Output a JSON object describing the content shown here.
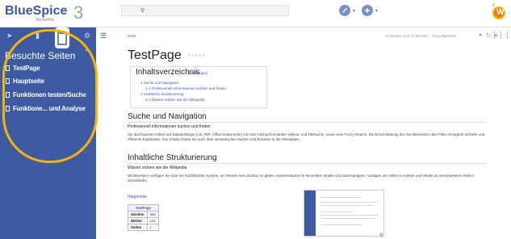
{
  "header": {
    "logo_text": "BlueSpice",
    "logo_sub": "MediaWiki",
    "logo_number": "3",
    "search_icon": "search-icon",
    "notif_label": "8",
    "avatar_letter": "W"
  },
  "sidebar": {
    "section_title": "Besuchte Seiten",
    "items": [
      {
        "label": "TestPage"
      },
      {
        "label": "Hauptseite"
      },
      {
        "label": "Funktionen testen/Suche"
      },
      {
        "label": "Funktione... und Analyse"
      }
    ]
  },
  "main": {
    "breadcrumb": "Seite",
    "meta": "6 Stunden und 22 Minuten - Greg Eigentum",
    "title": "TestPage",
    "toc": {
      "title": "Inhaltsverzeichnis",
      "hide_label": "[Verbergen]",
      "items": [
        {
          "label": "1   Suche und Navigation"
        },
        {
          "label": "1.1   Professionell informationen suchen und finden"
        },
        {
          "label": "2   Inhaltliche Strukturierung"
        },
        {
          "label": "2.1   Wissen ordnen wie die Wikipedia"
        }
      ]
    },
    "sections": [
      {
        "heading": "Suche und Navigation",
        "subheading": "Professionell informationen suchen und finden",
        "text": "Sie durchsuchen Artikel und Dateianhänge (z.B. PDF, Office-Dokumente) mit einer hochperformanten Volltext- und Titelsuche, sowie einer Fuzzy-Search. Die Einschränkung des Suchbereiches über Filter ermöglicht schnelle und effiziente Ergebnisse. Ihre Inhalte finden Sie auch über semantisches Suchen und Browsen in den Metadaten."
      },
      {
        "heading": "Inhaltliche Strukturierung",
        "subheading": "Wissen ordnen wie die Wikipedia",
        "text": "Mit BlueSpice verfügen Sie über ein hochflexibles System, um Wissen eine Struktur zu geben. Namensräume für besondere Inhalte und Nutzergruppen, Vorlagen um Artikel zu ordnen und Inhalte an verschiedenen Stellen einzubinden."
      }
    ],
    "link_hauptseite": "Hauptseite",
    "stats_table": {
      "header": "TestPage",
      "rows": [
        {
          "key": "Zeichen",
          "value": "966"
        },
        {
          "key": "Wörter",
          "value": "121"
        },
        {
          "key": "Seiten",
          "value": "1"
        }
      ]
    }
  }
}
